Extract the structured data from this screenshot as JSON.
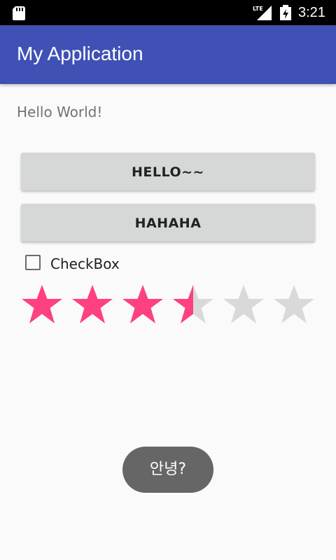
{
  "status_bar": {
    "time": "3:21",
    "network": "LTE",
    "icons": [
      "sd-card-icon",
      "signal-icon",
      "battery-icon"
    ]
  },
  "app_bar": {
    "title": "My Application",
    "color": "#3f51b5"
  },
  "content": {
    "hello_text": "Hello World!",
    "button1_label": "HELLO~~",
    "button2_label": "HAHAHA",
    "checkbox_label": "CheckBox",
    "checkbox_checked": false,
    "rating": {
      "value": 3.5,
      "max": 6,
      "active_color": "#ff4081",
      "inactive_color": "#d9d9d9"
    }
  },
  "toast": {
    "text": "안녕?"
  }
}
